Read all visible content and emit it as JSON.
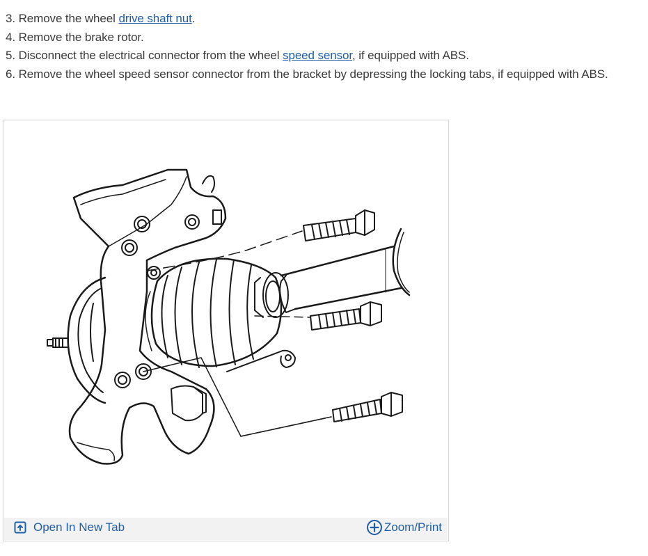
{
  "steps": [
    {
      "before": "3. Remove the wheel ",
      "link": "drive shaft nut",
      "after": "."
    },
    {
      "before": "4. Remove the brake rotor.",
      "link": "",
      "after": ""
    },
    {
      "before": "5. Disconnect the electrical connector from the wheel ",
      "link": "speed sensor",
      "after": ", if equipped with ABS."
    },
    {
      "before": "6. Remove the wheel speed sensor connector from the bracket by depressing the locking tabs, if equipped with ABS.",
      "link": "",
      "after": ""
    }
  ],
  "figure": {
    "open_label": "Open In New Tab",
    "zoom_label": "Zoom/Print",
    "open_icon": "open-in-new-tab-icon",
    "zoom_icon": "plus-circle-icon",
    "accent_color": "#1f5ea8"
  }
}
